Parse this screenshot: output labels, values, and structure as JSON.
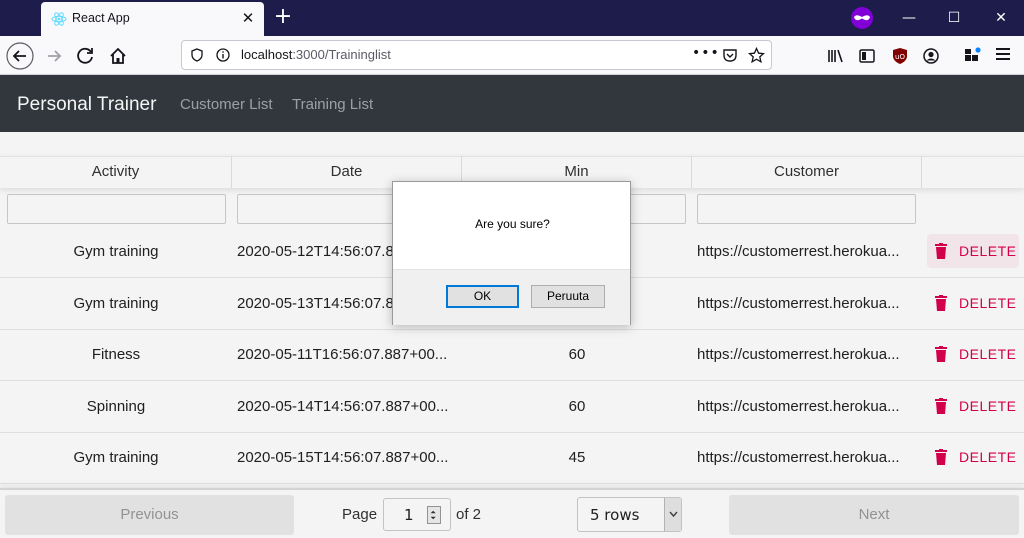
{
  "browser": {
    "tab_title": "React App",
    "url_host": "localhost",
    "url_path": ":3000/Traininglist"
  },
  "app": {
    "brand": "Personal Trainer",
    "nav": [
      "Customer List",
      "Training List"
    ]
  },
  "table": {
    "columns": [
      "Activity",
      "Date",
      "Min",
      "Customer",
      ""
    ],
    "rows": [
      {
        "activity": "Gym training",
        "date": "2020-05-12T14:56:07.887+00...",
        "min": "",
        "customer": "https://customerrest.herokua...",
        "action": "DELETE"
      },
      {
        "activity": "Gym training",
        "date": "2020-05-13T14:56:07.887+00...",
        "min": "",
        "customer": "https://customerrest.herokua...",
        "action": "DELETE"
      },
      {
        "activity": "Fitness",
        "date": "2020-05-11T16:56:07.887+00...",
        "min": "60",
        "customer": "https://customerrest.herokua...",
        "action": "DELETE"
      },
      {
        "activity": "Spinning",
        "date": "2020-05-14T14:56:07.887+00...",
        "min": "60",
        "customer": "https://customerrest.herokua...",
        "action": "DELETE"
      },
      {
        "activity": "Gym training",
        "date": "2020-05-15T14:56:07.887+00...",
        "min": "45",
        "customer": "https://customerrest.herokua...",
        "action": "DELETE"
      }
    ]
  },
  "pagination": {
    "previous": "Previous",
    "page_label": "Page",
    "page_value": "1",
    "of_label": "of 2",
    "rows_value": "5 rows",
    "next": "Next"
  },
  "dialog": {
    "message": "Are you sure?",
    "ok": "OK",
    "cancel": "Peruuta"
  },
  "colors": {
    "delete": "#dc004e",
    "header_bg": "#343a40",
    "tabbar_bg": "#1e1c4b"
  }
}
